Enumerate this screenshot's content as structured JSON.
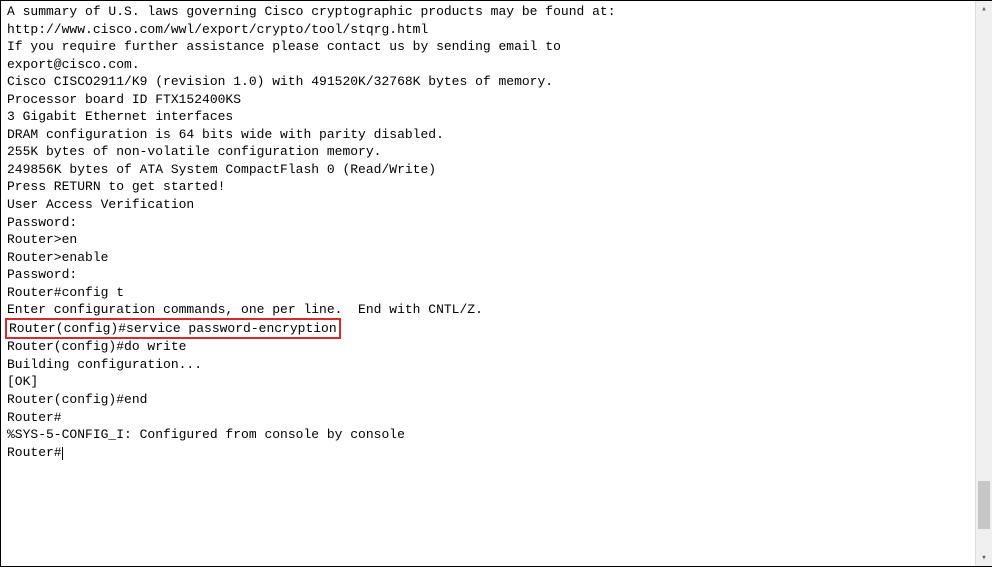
{
  "terminal": {
    "lines": [
      "A summary of U.S. laws governing Cisco cryptographic products may be found at:",
      "http://www.cisco.com/wwl/export/crypto/tool/stqrg.html",
      "",
      "If you require further assistance please contact us by sending email to",
      "export@cisco.com.",
      "",
      "Cisco CISCO2911/K9 (revision 1.0) with 491520K/32768K bytes of memory.",
      "Processor board ID FTX152400KS",
      "3 Gigabit Ethernet interfaces",
      "DRAM configuration is 64 bits wide with parity disabled.",
      "255K bytes of non-volatile configuration memory.",
      "249856K bytes of ATA System CompactFlash 0 (Read/Write)",
      "",
      "Press RETURN to get started!",
      "",
      "",
      "",
      "User Access Verification",
      "",
      "Password:",
      "",
      "Router>en",
      "Router>enable",
      "Password:",
      "Router#config t",
      "Enter configuration commands, one per line.  End with CNTL/Z."
    ],
    "highlighted_line": "Router(config)#service password-encryption",
    "lines_after": [
      "Router(config)#do write",
      "Building configuration...",
      "[OK]",
      "Router(config)#end",
      "Router#",
      "%SYS-5-CONFIG_I: Configured from console by console",
      "",
      "Router#"
    ]
  },
  "scrollbar": {
    "thumb_top_pct": 87,
    "thumb_height_pct": 9
  },
  "icons": {
    "up_arrow": "▴",
    "down_arrow": "▾"
  }
}
